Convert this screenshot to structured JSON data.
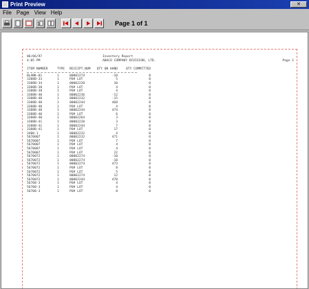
{
  "window": {
    "title": "Print Preview"
  },
  "menu": [
    "File",
    "Page",
    "View",
    "Help"
  ],
  "toolbar": {
    "page_label": "Page 1 of 1"
  },
  "report": {
    "header_left": [
      "06/06/97",
      "4:05 PM"
    ],
    "header_center": [
      "Inventory Report",
      "ABACO COMPANY DIVISION, LTD."
    ],
    "header_right": [
      "",
      "Page 1"
    ],
    "columns": [
      "ITEM NUMBER",
      "TYPE",
      "RECEIPT_NUM",
      "QTY ON HAND",
      "QTY COMMITTED"
    ],
    "rows": [
      [
        "BLANK-01",
        "1",
        "00002274",
        "-10",
        "0"
      ],
      [
        "3388B-33",
        "1",
        "PO# LOT",
        "5",
        "0"
      ],
      [
        "3388B-34",
        "1",
        "00002220",
        "10",
        "0"
      ],
      [
        "3388B-38",
        "1",
        "PO# LOT",
        "4",
        "0"
      ],
      [
        "3388B-38",
        "1",
        "PO# LOT",
        "4",
        "0"
      ],
      [
        "3388B-40",
        "1",
        "00002236",
        "-12",
        "0"
      ],
      [
        "3388B-40",
        "1",
        "00002232",
        "-15",
        "0"
      ],
      [
        "3388B-40",
        "1",
        "00002244",
        "468",
        "0"
      ],
      [
        "3388B-40",
        "1",
        "PO# LOT",
        "4",
        "0"
      ],
      [
        "3388B-40",
        "1",
        "00002244",
        "474",
        "0"
      ],
      [
        "3388B-40",
        "1",
        "PO# LOT",
        "6",
        "0"
      ],
      [
        "3388B-40",
        "1",
        "00002264",
        "3",
        "0"
      ],
      [
        "3388B-41",
        "1",
        "00002220",
        "3",
        "0"
      ],
      [
        "3388B-41",
        "1",
        "00002244",
        "7",
        "0"
      ],
      [
        "3388B-41",
        "1",
        "PO# LOT",
        "17",
        "0"
      ],
      [
        "3400-1",
        "1",
        "00002232",
        "4",
        "0"
      ],
      [
        "5670007",
        "1",
        "00002232",
        "471",
        "0"
      ],
      [
        "5670007",
        "1",
        "PO# LOT",
        "7",
        "0"
      ],
      [
        "5670007",
        "1",
        "PO# LOT",
        "4",
        "0"
      ],
      [
        "5670007",
        "1",
        "PO# LOT",
        "4",
        "0"
      ],
      [
        "5670007",
        "1",
        "PO# LOT",
        "22",
        "0"
      ],
      [
        "5670072",
        "1",
        "00002274",
        "-10",
        "0"
      ],
      [
        "5670072",
        "1",
        "00002274",
        "-10",
        "0"
      ],
      [
        "5670072",
        "1",
        "00002274",
        "473",
        "0"
      ],
      [
        "5670072",
        "1",
        "PO# LOT",
        "8",
        "0"
      ],
      [
        "5670072",
        "1",
        "PO# LOT",
        "5",
        "0"
      ],
      [
        "5670072",
        "1",
        "00002274",
        "12",
        "0"
      ],
      [
        "5670072",
        "1",
        "00002244",
        "470",
        "0"
      ],
      [
        "56708-3",
        "1",
        "PO# LOT",
        "4",
        "0"
      ],
      [
        "56708-3",
        "1",
        "PO# LOT",
        "4",
        "0"
      ],
      [
        "56708-3",
        "1",
        "PO# LOT",
        "8",
        "0"
      ]
    ]
  }
}
